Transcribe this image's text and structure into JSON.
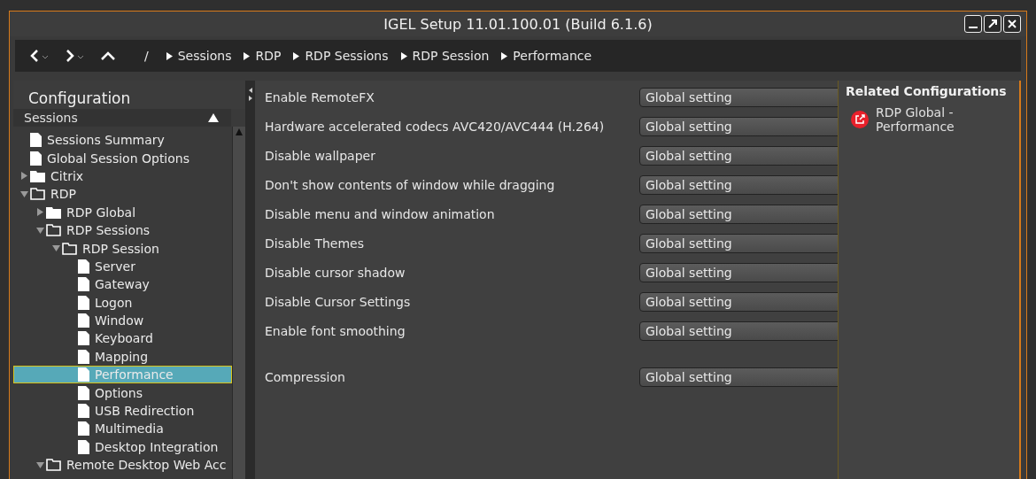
{
  "window": {
    "title": "IGEL Setup 11.01.100.01 (Build 6.1.6)"
  },
  "breadcrumb": [
    "/",
    "Sessions",
    "RDP",
    "RDP Sessions",
    "RDP Session",
    "Performance"
  ],
  "sidebar": {
    "title": "Configuration",
    "section": "Sessions",
    "tree": [
      {
        "label": "Sessions Summary",
        "kind": "file",
        "selected": false
      },
      {
        "label": "Global Session Options",
        "kind": "file",
        "selected": false
      },
      {
        "label": "Citrix",
        "kind": "folder",
        "expanded": false,
        "selected": false
      },
      {
        "label": "RDP",
        "kind": "folder",
        "expanded": true,
        "selected": false,
        "children": [
          {
            "label": "RDP Global",
            "kind": "folder",
            "expanded": false,
            "selected": false
          },
          {
            "label": "RDP Sessions",
            "kind": "folder",
            "expanded": true,
            "selected": false,
            "children": [
              {
                "label": "RDP Session",
                "kind": "folder",
                "expanded": true,
                "selected": false,
                "children": [
                  {
                    "label": "Server",
                    "kind": "file",
                    "selected": false
                  },
                  {
                    "label": "Gateway",
                    "kind": "file",
                    "selected": false
                  },
                  {
                    "label": "Logon",
                    "kind": "file",
                    "selected": false
                  },
                  {
                    "label": "Window",
                    "kind": "file",
                    "selected": false
                  },
                  {
                    "label": "Keyboard",
                    "kind": "file",
                    "selected": false
                  },
                  {
                    "label": "Mapping",
                    "kind": "file",
                    "selected": false
                  },
                  {
                    "label": "Performance",
                    "kind": "file",
                    "selected": true
                  },
                  {
                    "label": "Options",
                    "kind": "file",
                    "selected": false
                  },
                  {
                    "label": "USB Redirection",
                    "kind": "file",
                    "selected": false
                  },
                  {
                    "label": "Multimedia",
                    "kind": "file",
                    "selected": false
                  },
                  {
                    "label": "Desktop Integration",
                    "kind": "file",
                    "selected": false
                  }
                ]
              }
            ]
          },
          {
            "label": "Remote Desktop Web Acc",
            "kind": "folder",
            "expanded": true,
            "selected": false
          }
        ]
      }
    ]
  },
  "settings": [
    {
      "label": "Enable RemoteFX",
      "value": "Global setting"
    },
    {
      "label": "Hardware accelerated codecs AVC420/AVC444 (H.264)",
      "value": "Global setting"
    },
    {
      "label": "Disable wallpaper",
      "value": "Global setting"
    },
    {
      "label": "Don't show contents of window while dragging",
      "value": "Global setting"
    },
    {
      "label": "Disable menu and window animation",
      "value": "Global setting"
    },
    {
      "label": "Disable Themes",
      "value": "Global setting"
    },
    {
      "label": "Disable cursor shadow",
      "value": "Global setting"
    },
    {
      "label": "Disable Cursor Settings",
      "value": "Global setting"
    },
    {
      "label": "Enable font smoothing",
      "value": "Global setting"
    },
    {
      "label": "Compression",
      "value": "Global setting",
      "separated": true
    }
  ],
  "related": {
    "title": "Related Configurations",
    "links": [
      "RDP Global - Performance"
    ]
  }
}
